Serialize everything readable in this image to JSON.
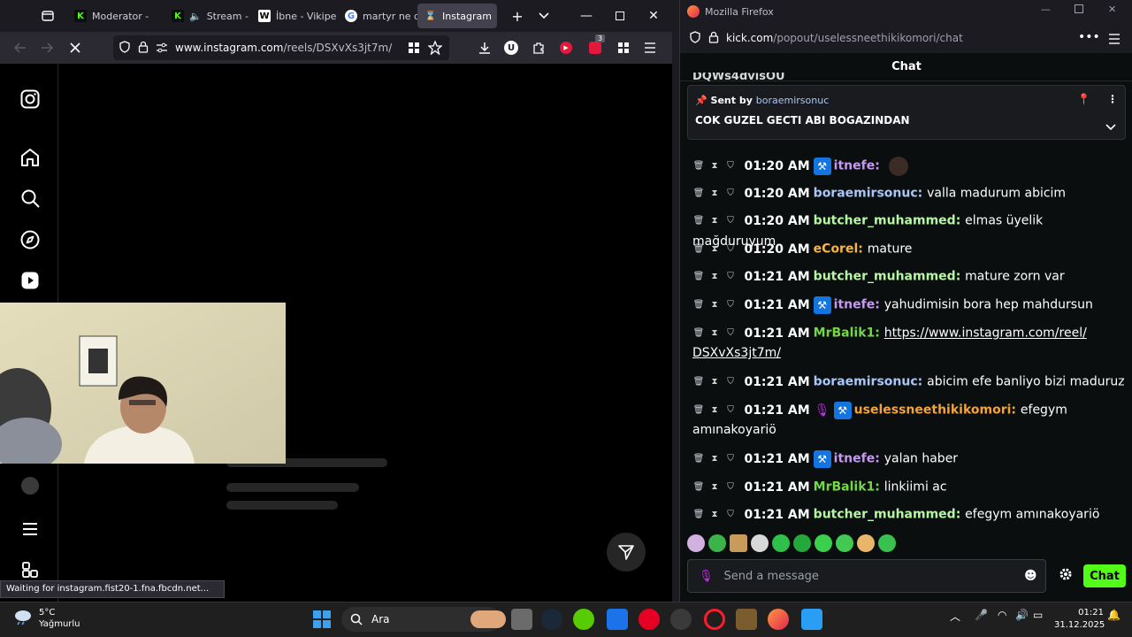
{
  "left_browser": {
    "tabs": [
      {
        "label": "Moderator - ",
        "favicon_color": "#53fc18",
        "favicon_text": "K"
      },
      {
        "label": "Stream - ",
        "favicon_color": "#53fc18",
        "favicon_text": "K"
      },
      {
        "label": "İbne - Vikipe",
        "favicon_color": "#ffffff",
        "favicon_text": "W"
      },
      {
        "label": "martyr ne de",
        "favicon_color": "#4285f4",
        "favicon_text": "G"
      },
      {
        "label": "Instagram",
        "favicon_color": "#cfcfd8",
        "favicon_text": "⌛"
      }
    ],
    "url_host": "www.instagram.com",
    "url_path": "/reels/DSXvXs3jt7m/",
    "status_text": "Waiting for instagram.fist20-1.fna.fbcdn.net...",
    "extension_badge": "3"
  },
  "right_browser": {
    "title": "Mozilla Firefox",
    "url_host": "kick.com",
    "url_path": "/popout/uselessneethikikomori/chat",
    "chat_header": "Chat",
    "pinned_cut_text": "DQWs4dvisOU",
    "pinned": {
      "sent_by_label": "Sent by",
      "sent_by_user": "boraemirsonuc",
      "message": "COK GUZEL GECTI ABI BOGAZINDAN"
    },
    "messages": [
      {
        "time": "01:20 AM",
        "user": "itnefe",
        "color": "#c797f4",
        "badge": true,
        "mic": false,
        "text": "",
        "emote": true
      },
      {
        "time": "01:20 AM",
        "user": "boraemirsonuc",
        "color": "#a9c6f7",
        "badge": false,
        "mic": false,
        "text": "valla madurum abicim"
      },
      {
        "time": "01:20 AM",
        "user": "butcher_muhammed",
        "color": "#b6f7a3",
        "badge": false,
        "mic": false,
        "text": "elmas üyelik mağduruyum"
      },
      {
        "time": "01:20 AM",
        "user": "eCorel",
        "color": "#f2b54b",
        "badge": false,
        "mic": false,
        "text": "mature"
      },
      {
        "time": "01:21 AM",
        "user": "butcher_muhammed",
        "color": "#b6f7a3",
        "badge": false,
        "mic": false,
        "text": "mature zorn var"
      },
      {
        "time": "01:21 AM",
        "user": "itnefe",
        "color": "#c797f4",
        "badge": true,
        "mic": false,
        "text": "yahudimisin bora hep mahdursun"
      },
      {
        "time": "01:21 AM",
        "user": "MrBalik1",
        "color": "#72d846",
        "badge": false,
        "mic": false,
        "link_line1": "https://www.instagram.com/reel/",
        "link_line2": "DSXvXs3jt7m/"
      },
      {
        "time": "01:21 AM",
        "user": "boraemirsonuc",
        "color": "#a9c6f7",
        "badge": false,
        "mic": false,
        "text": "abicim efe banliyo bizi maduruz"
      },
      {
        "time": "01:21 AM",
        "user": "uselessneethikikomori",
        "color": "#f2a33a",
        "badge": true,
        "mic": true,
        "text": "efegym",
        "text2": "amınakoyariö"
      },
      {
        "time": "01:21 AM",
        "user": "itnefe",
        "color": "#c797f4",
        "badge": true,
        "mic": false,
        "text": "yalan haber"
      },
      {
        "time": "01:21 AM",
        "user": "MrBalik1",
        "color": "#72d846",
        "badge": false,
        "mic": false,
        "text": "linkiimi ac"
      },
      {
        "time": "01:21 AM",
        "user": "butcher_muhammed",
        "color": "#b6f7a3",
        "badge": false,
        "mic": false,
        "text": "efegym amınakoyariö"
      }
    ],
    "send_placeholder": "Send a message",
    "send_button": "Chat"
  },
  "taskbar": {
    "temperature": "5°C",
    "weather": "Yağmurlu",
    "search_label": "Ara",
    "time": "01:21",
    "date": "31.12.2025"
  }
}
